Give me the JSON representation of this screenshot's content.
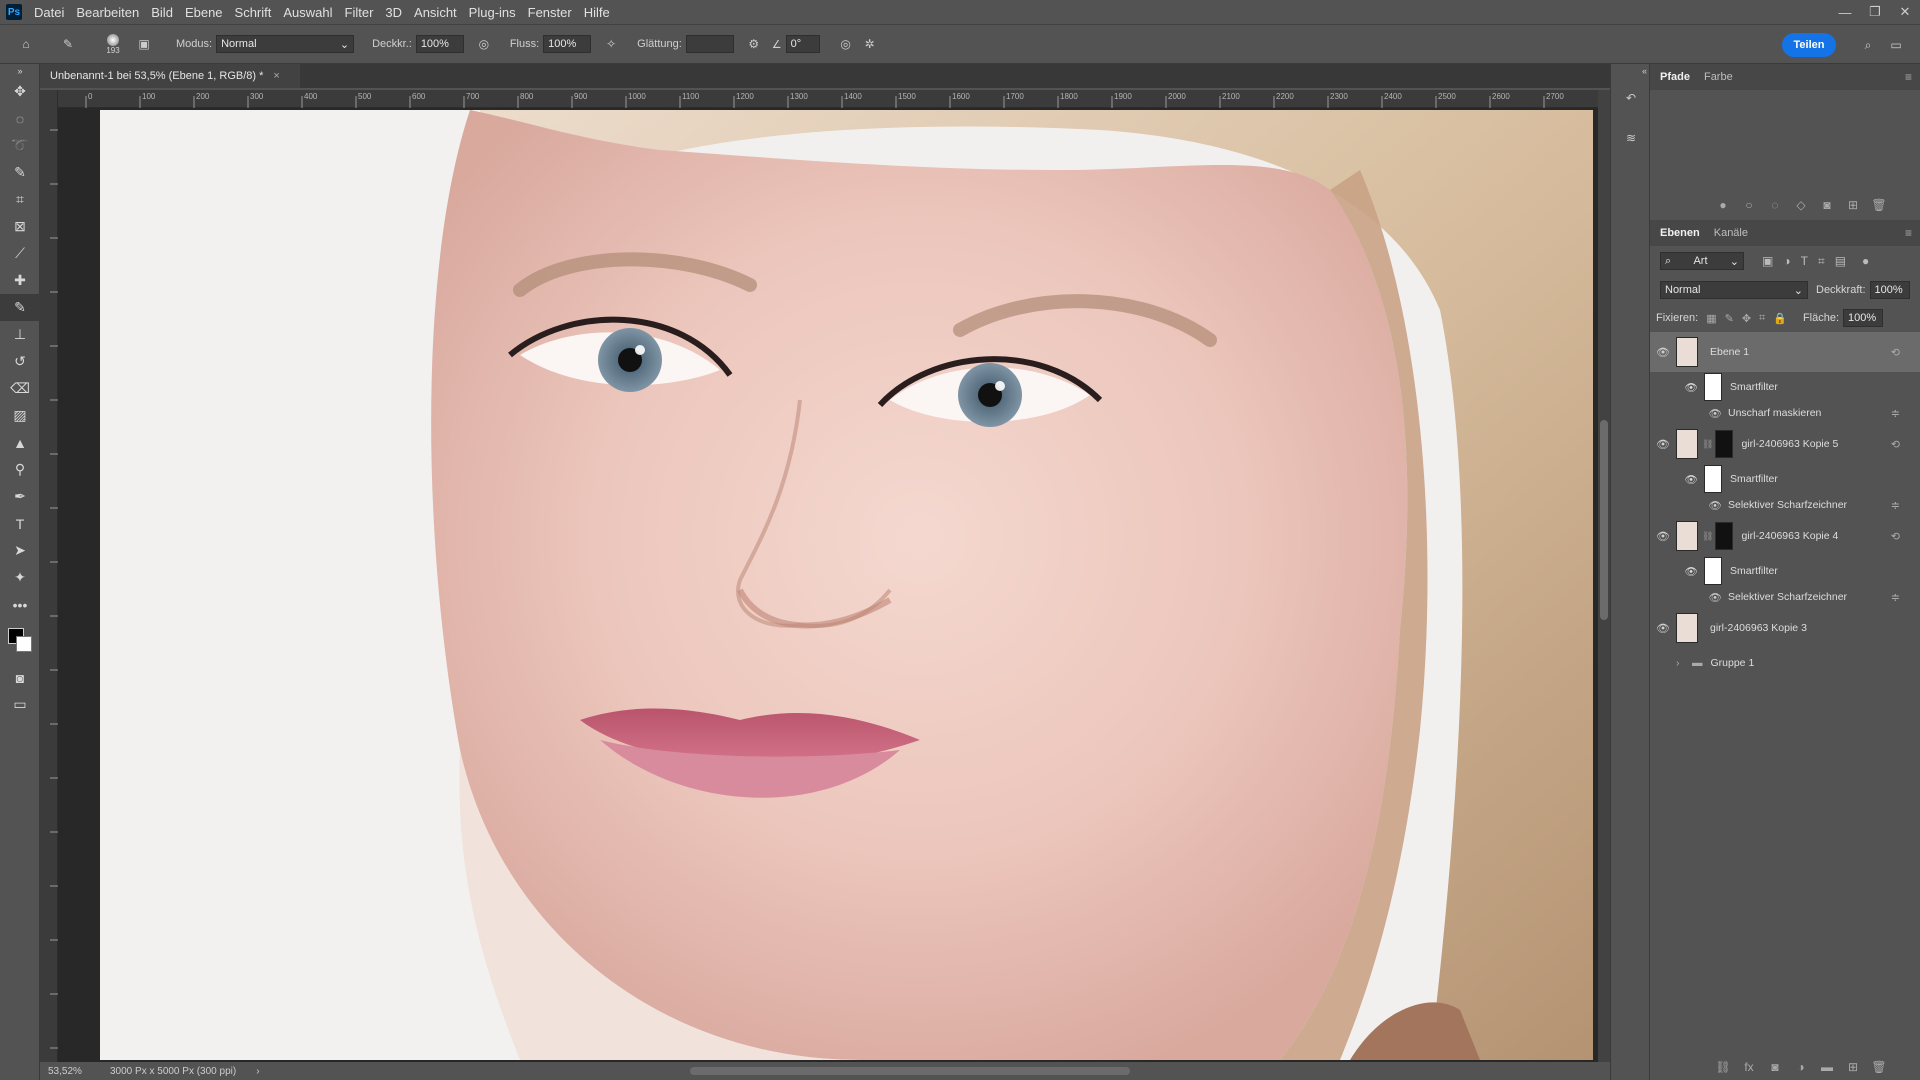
{
  "app": {
    "logo": "Ps"
  },
  "menu": [
    "Datei",
    "Bearbeiten",
    "Bild",
    "Ebene",
    "Schrift",
    "Auswahl",
    "Filter",
    "3D",
    "Ansicht",
    "Plug-ins",
    "Fenster",
    "Hilfe"
  ],
  "options": {
    "brush_size": "193",
    "mode_label": "Modus:",
    "mode_value": "Normal",
    "opacity_label": "Deckkr.:",
    "opacity_value": "100%",
    "flow_label": "Fluss:",
    "flow_value": "100%",
    "smoothing_label": "Glättung:",
    "smoothing_value": "",
    "angle_value": "0°",
    "share_label": "Teilen"
  },
  "document": {
    "tab_title": "Unbenannt-1 bei 53,5% (Ebene 1, RGB/8) *",
    "zoom": "53,52%",
    "doc_info": "3000 Px x 5000 Px (300 ppi)"
  },
  "ruler": {
    "top_labels": [
      "0",
      "100",
      "200",
      "300",
      "400",
      "500",
      "600",
      "700",
      "800",
      "900",
      "1000",
      "1100",
      "1200",
      "1300",
      "1400",
      "1500",
      "1600",
      "1700",
      "1800",
      "1900",
      "2000",
      "2100",
      "2200",
      "2300",
      "2400",
      "2500",
      "2600",
      "2700"
    ]
  },
  "panels": {
    "top_tabs": [
      "Pfade",
      "Farbe"
    ],
    "layer_tabs": [
      "Ebenen",
      "Kanäle"
    ],
    "filter_kind": "Art",
    "blend_mode": "Normal",
    "opacity_label": "Deckkraft:",
    "opacity_value": "100%",
    "lock_label": "Fixieren:",
    "fill_label": "Fläche:",
    "fill_value": "100%"
  },
  "layers": {
    "ebene1": "Ebene 1",
    "sf1": "Smartfilter",
    "unsharp": "Unscharf maskieren",
    "kopie5": "girl-2406963 Kopie 5",
    "sf2": "Smartfilter",
    "sel1": "Selektiver Scharfzeichner",
    "kopie4": "girl-2406963 Kopie 4",
    "sf3": "Smartfilter",
    "sel2": "Selektiver Scharfzeichner",
    "kopie3": "girl-2406963 Kopie 3",
    "gruppe": "Gruppe 1"
  },
  "colors": {
    "accent": "#1473e6",
    "panel_bg": "#535353"
  }
}
